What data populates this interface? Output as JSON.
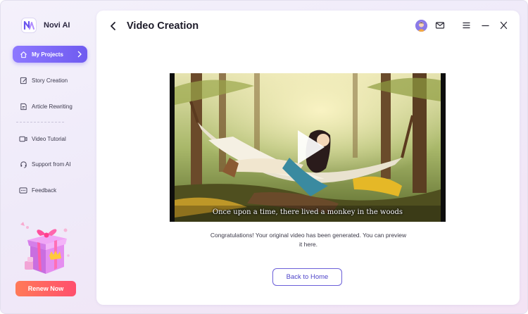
{
  "app": {
    "name": "Novi AI"
  },
  "sidebar": {
    "items": [
      {
        "label": "My Projects",
        "icon": "home-icon",
        "active": true
      },
      {
        "label": "Story Creation",
        "icon": "edit-icon"
      },
      {
        "label": "Article Rewriting",
        "icon": "document-edit-icon"
      },
      {
        "label": "Video Tutorial",
        "icon": "video-icon"
      },
      {
        "label": "Support from AI",
        "icon": "headset-icon"
      },
      {
        "label": "Feedback",
        "icon": "chat-icon"
      }
    ],
    "renew_label": "Renew Now"
  },
  "header": {
    "title": "Video Creation",
    "icons": [
      "back-arrow-icon",
      "avatar",
      "mail-icon",
      "menu-icon",
      "minimize-icon",
      "close-icon"
    ]
  },
  "video": {
    "subtitle": "Once upon a time, there lived a monkey in the woods"
  },
  "content": {
    "message": "Congratulations! Your original video has been generated. You can preview it here.",
    "home_button_label": "Back to Home"
  },
  "colors": {
    "accent": "#7462f2",
    "renew": "#ff5f62",
    "title": "#1d1b29"
  }
}
